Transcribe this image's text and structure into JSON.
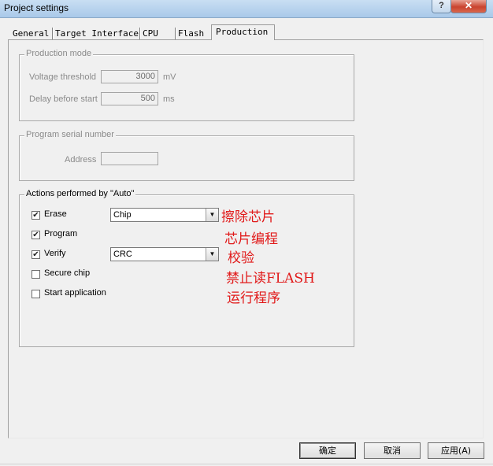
{
  "window": {
    "title": "Project settings",
    "help_glyph": "?",
    "close_glyph": "✕"
  },
  "tabs": [
    {
      "label": "General"
    },
    {
      "label": "Target Interface"
    },
    {
      "label": "CPU"
    },
    {
      "label": "Flash"
    },
    {
      "label": "Production"
    }
  ],
  "production_mode": {
    "title": "Production mode",
    "voltage_label": "Voltage threshold",
    "voltage_value": "3000",
    "voltage_unit": "mV",
    "delay_label": "Delay before start",
    "delay_value": "500",
    "delay_unit": "ms"
  },
  "serial": {
    "title": "Program serial number",
    "address_label": "Address",
    "address_value": ""
  },
  "actions": {
    "title": "Actions performed by \"Auto\"",
    "items": [
      {
        "label": "Erase",
        "checked": true,
        "select_value": "Chip"
      },
      {
        "label": "Program",
        "checked": true
      },
      {
        "label": "Verify",
        "checked": true,
        "select_value": "CRC"
      },
      {
        "label": "Secure chip",
        "checked": false
      },
      {
        "label": "Start application",
        "checked": false
      }
    ]
  },
  "annotations": [
    "擦除芯片",
    "芯片编程",
    "校验",
    "禁止读FLASH",
    "运行程序"
  ],
  "buttons": {
    "ok": "确定",
    "cancel": "取消",
    "apply": "应用(A)"
  },
  "colors": {
    "annotation": "#e11919",
    "close_button": "#c9432f"
  },
  "icons": {
    "check": "✔",
    "dropdown": "▼"
  }
}
